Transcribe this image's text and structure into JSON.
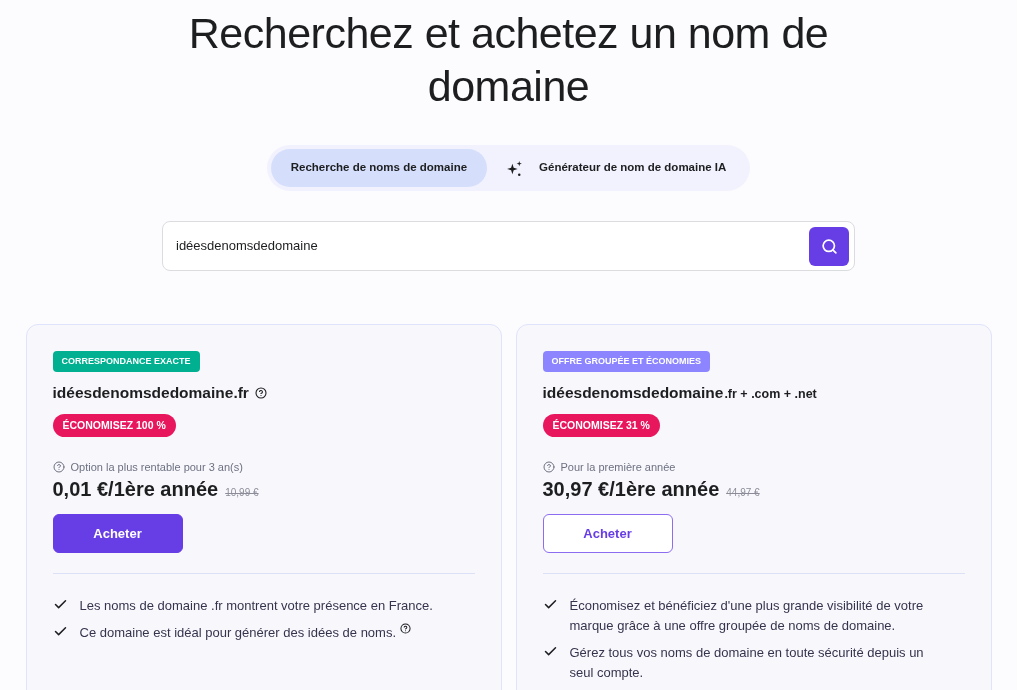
{
  "heading": "Recherchez et achetez un nom de domaine",
  "tabs": [
    {
      "label": "Recherche de noms de domaine",
      "selected": true,
      "kind": "plain"
    },
    {
      "label": "Générateur de nom de domaine IA",
      "selected": false,
      "kind": "ai"
    }
  ],
  "search": {
    "value": "idéesdenomsdedomaine"
  },
  "offers": [
    {
      "tag": {
        "label": "CORRESPONDANCE EXACTE",
        "color": "#00b090"
      },
      "domain": "idéesdenomsdedomaine.fr",
      "help": true,
      "discount": "ÉCONOMISEZ 100 %",
      "note": "Option la plus rentable pour 3 an(s)",
      "price": "0,01 €/1ère année",
      "old_price": "10,99 €",
      "button": {
        "label": "Acheter",
        "kind": "primary"
      },
      "features": [
        {
          "text": "Les noms de domaine .fr montrent votre présence en France.",
          "help": false
        },
        {
          "text": "Ce domaine est idéal pour générer des idées de noms.",
          "help": true
        }
      ]
    },
    {
      "tag": {
        "label": "OFFRE GROUPÉE ET ÉCONOMIES",
        "color": "#8c85ff"
      },
      "domain": "idéesdenomsdedomaine",
      "extensions": ".fr + .com + .net",
      "help": false,
      "discount": "ÉCONOMISEZ 31 %",
      "note": "Pour la première année",
      "price": "30,97 €/1ère année",
      "old_price": "44,97 €",
      "button": {
        "label": "Acheter",
        "kind": "outline"
      },
      "features": [
        {
          "text": "Économisez et bénéficiez d'une plus grande visibilité de votre marque grâce à une offre groupée de noms de domaine.",
          "help": false
        },
        {
          "text": "Gérez tous vos noms de domaine en toute sécurité depuis un seul compte.",
          "help": false
        }
      ]
    }
  ]
}
